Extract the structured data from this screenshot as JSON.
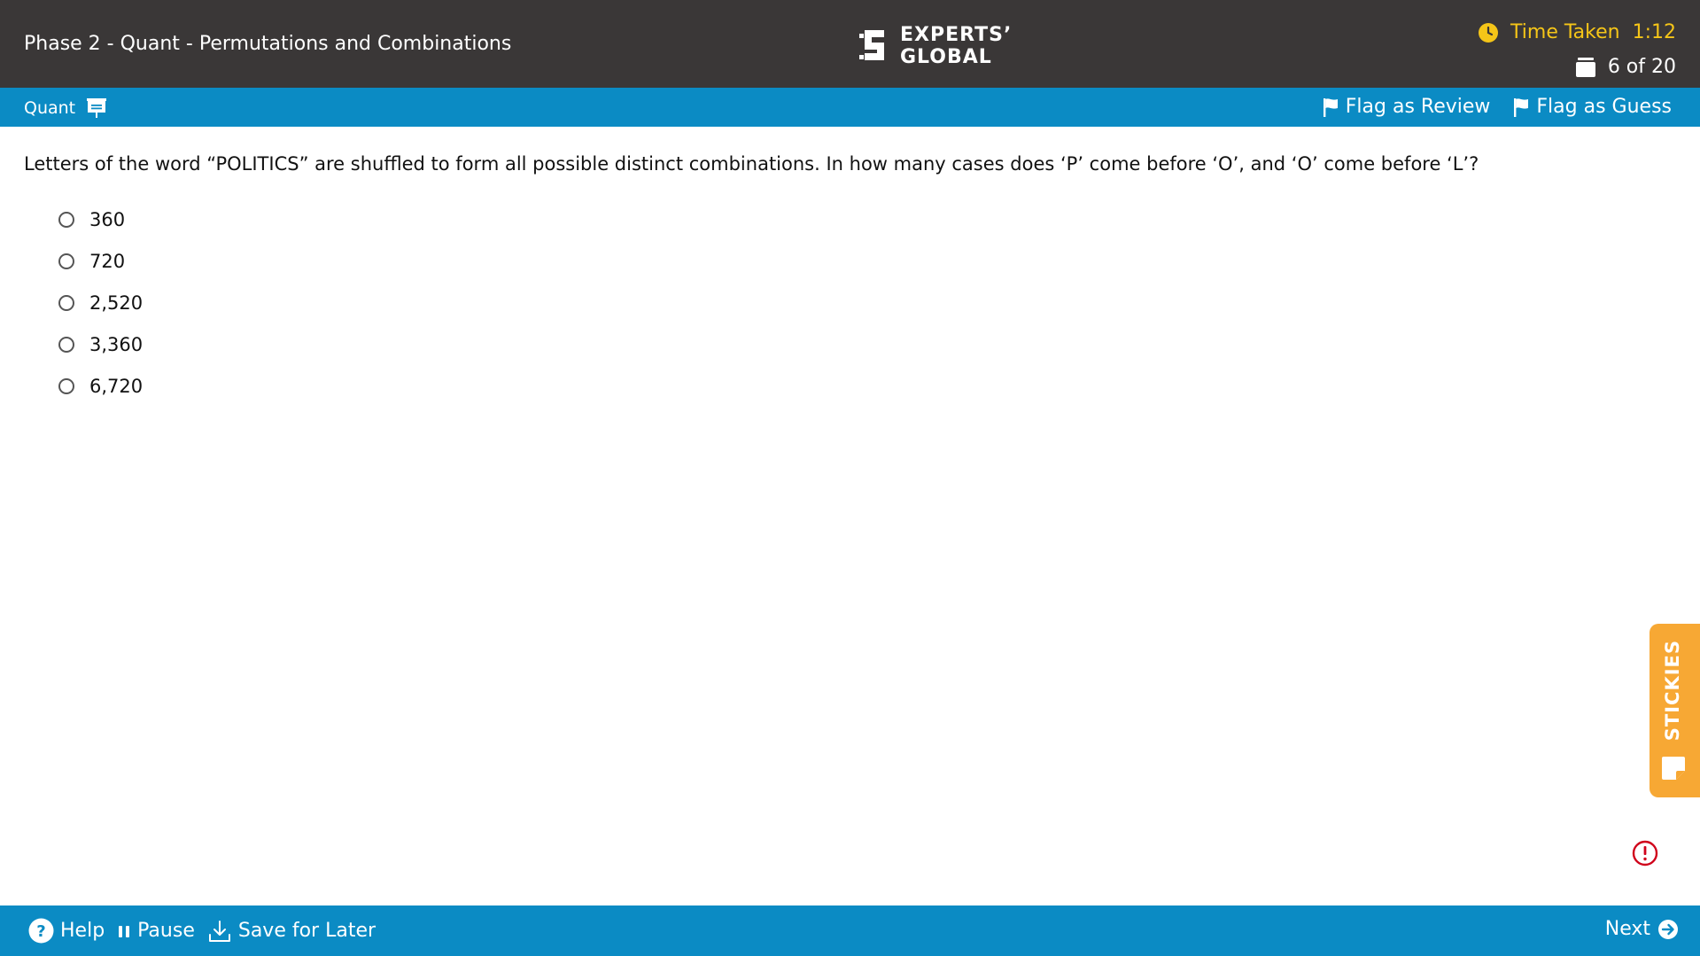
{
  "header": {
    "title": "Phase 2 - Quant - Permutations and Combinations",
    "logo_line1": "EXPERTS’",
    "logo_line2": "GLOBAL",
    "timer_label": "Time Taken",
    "timer_value": "1:12",
    "question_counter": "6 of 20"
  },
  "subbar": {
    "section": "Quant",
    "flag_review": "Flag as Review",
    "flag_guess": "Flag as Guess"
  },
  "question": {
    "text": "Letters of the word “POLITICS” are shuffled to form all possible distinct combinations. In how many cases does ‘P’ come before ‘O’, and ‘O’ come before ‘L’?",
    "options": [
      "360",
      "720",
      "2,520",
      "3,360",
      "6,720"
    ]
  },
  "stickies_label": "STICKIES",
  "footer": {
    "help": "Help",
    "pause": "Pause",
    "save": "Save for Later",
    "next": "Next"
  },
  "colors": {
    "topbar": "#3a3737",
    "accent_blue": "#0b8bc4",
    "timer_yellow": "#f5c518",
    "stickies_orange": "#f7a834",
    "alert_red": "#d0021b"
  }
}
